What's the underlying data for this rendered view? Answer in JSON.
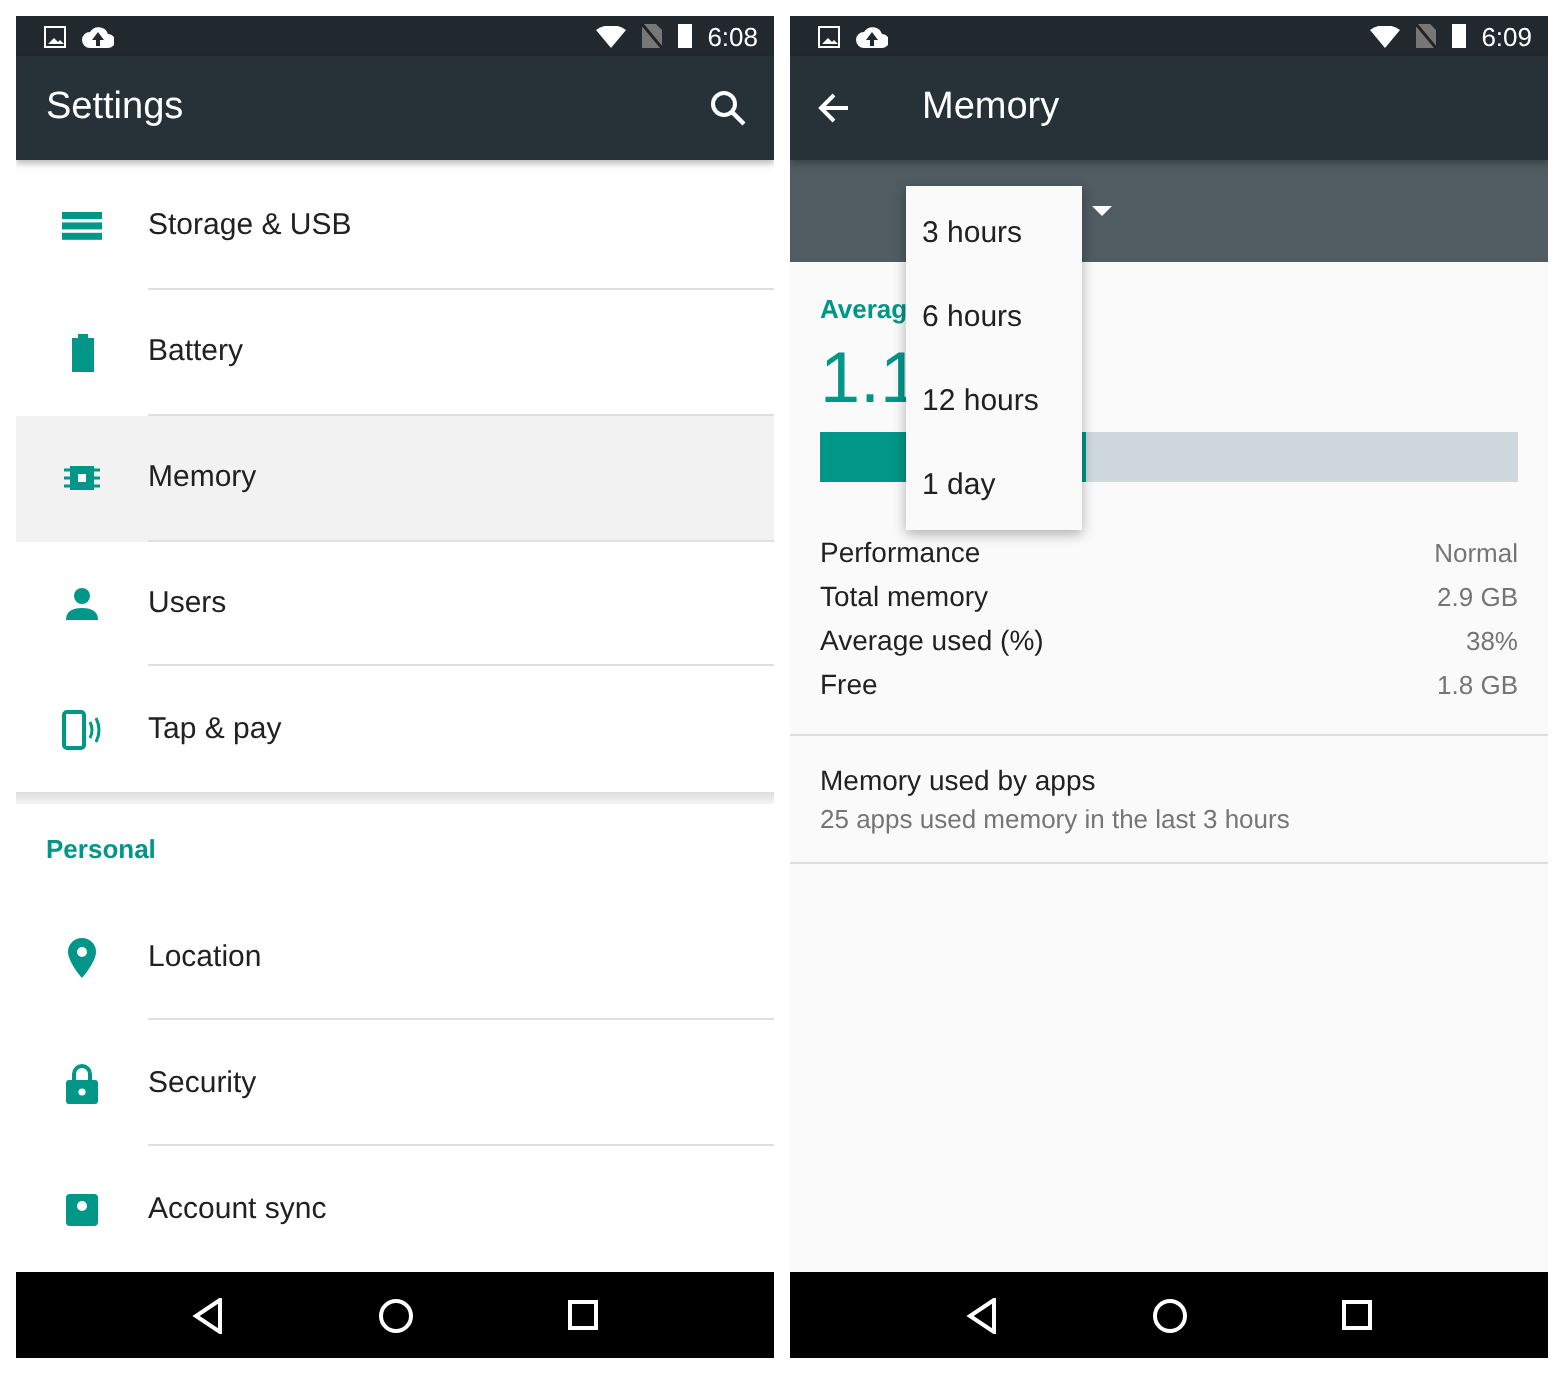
{
  "settings_screen": {
    "status_time": "6:08",
    "title": "Settings",
    "sections": [
      {
        "items": [
          {
            "label": "Storage & USB",
            "selected": false
          },
          {
            "label": "Battery",
            "selected": false
          },
          {
            "label": "Memory",
            "selected": true
          },
          {
            "label": "Users",
            "selected": false
          },
          {
            "label": "Tap & pay",
            "selected": false
          }
        ]
      },
      {
        "header": "Personal",
        "items": [
          {
            "label": "Location",
            "selected": false
          },
          {
            "label": "Security",
            "selected": false
          },
          {
            "label": "Account sync",
            "selected": false
          }
        ]
      }
    ]
  },
  "memory_screen": {
    "status_time": "6:09",
    "title": "Memory",
    "period_menu": [
      "3 hours",
      "6 hours",
      "12 hours",
      "1 day"
    ],
    "summary_label": "Averag",
    "summary_value": "1.1",
    "usage_bar": {
      "level": 0.38
    },
    "stats": [
      {
        "label": "Performance",
        "value": "Normal"
      },
      {
        "label": "Total memory",
        "value": "2.9 GB"
      },
      {
        "label": "Average used (%)",
        "value": "38%"
      },
      {
        "label": "Free",
        "value": "1.8 GB"
      }
    ],
    "apps": {
      "title": "Memory used by apps",
      "subtitle": "25 apps used memory in the last 3 hours"
    }
  }
}
